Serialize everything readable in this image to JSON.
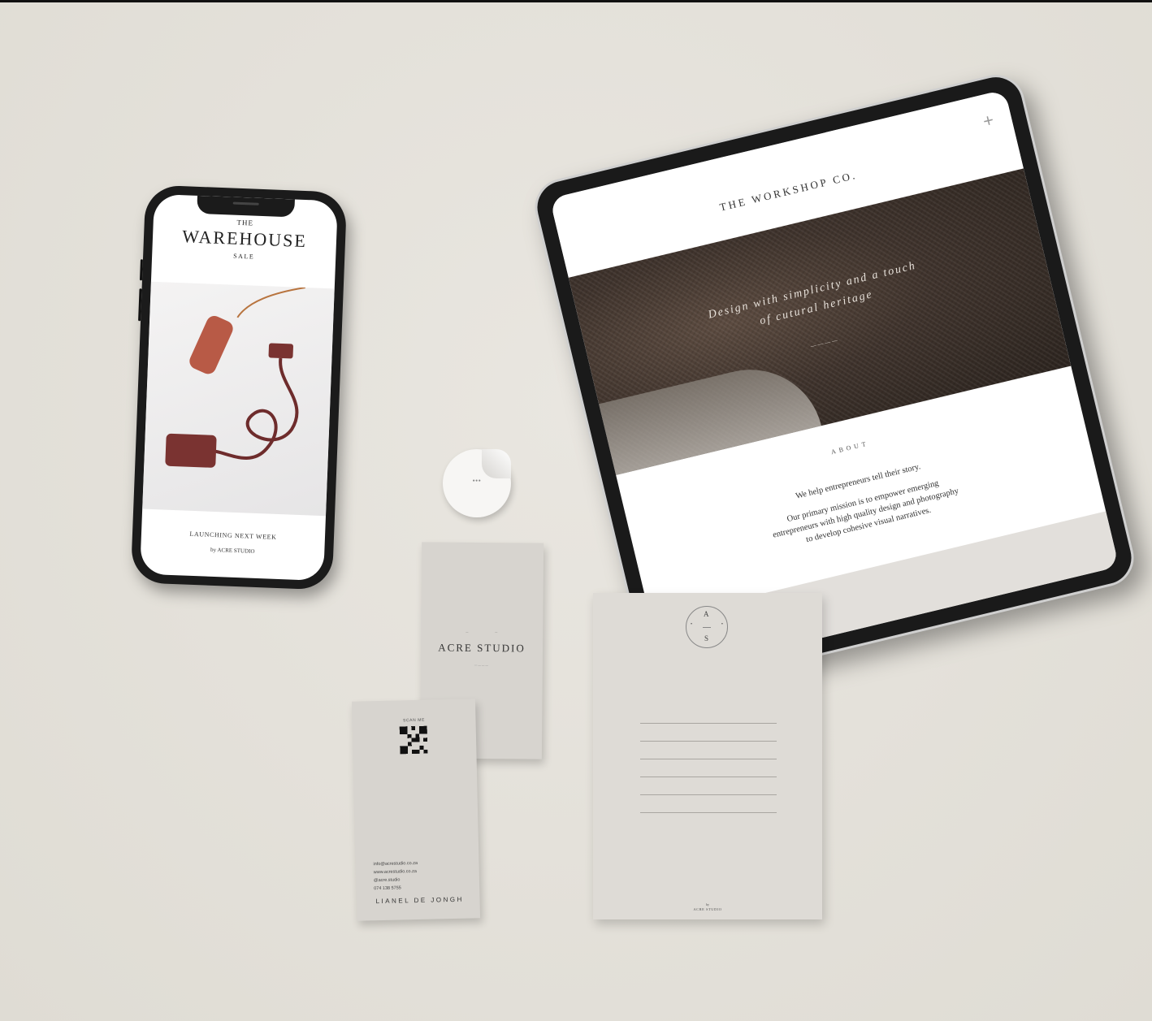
{
  "phone": {
    "the": "THE",
    "title": "WAREHOUSE",
    "sale": "SALE",
    "launch": "LAUNCHING NEXT WEEK",
    "by": "by ACRE STUDIO"
  },
  "tablet": {
    "brand": "THE WORKSHOP CO.",
    "tagline_1": "Design with simplicity and a touch",
    "tagline_2": "of cutural heritage",
    "about": "ABOUT",
    "lead": "We help entrepreneurs tell their story.",
    "mission_1": "Our primary mission is to empower emerging",
    "mission_2": "entrepreneurs with high quality design and photography",
    "mission_3": "to develop cohesive visual narratives."
  },
  "business_card_back": {
    "scan": "SCAN ME",
    "email": "info@acrestudio.co.za",
    "website": "www.acrestudio.co.za",
    "handle": "@acre.studio",
    "phone": "074 138 5755",
    "name": "LIANEL DE JONGH"
  },
  "business_card_front": {
    "brand": "ACRE STUDIO"
  },
  "letterhead": {
    "monogram_top": "A",
    "monogram_bottom": "S",
    "by": "by",
    "brand": "ACRE STUDIO"
  },
  "colors": {
    "background": "#e4e1da",
    "device_frame": "#1b1b1b",
    "card_stock": "#d7d4cf",
    "lamp_terracotta": "#b85a46",
    "lamp_burgundy": "#6e2c2c"
  }
}
